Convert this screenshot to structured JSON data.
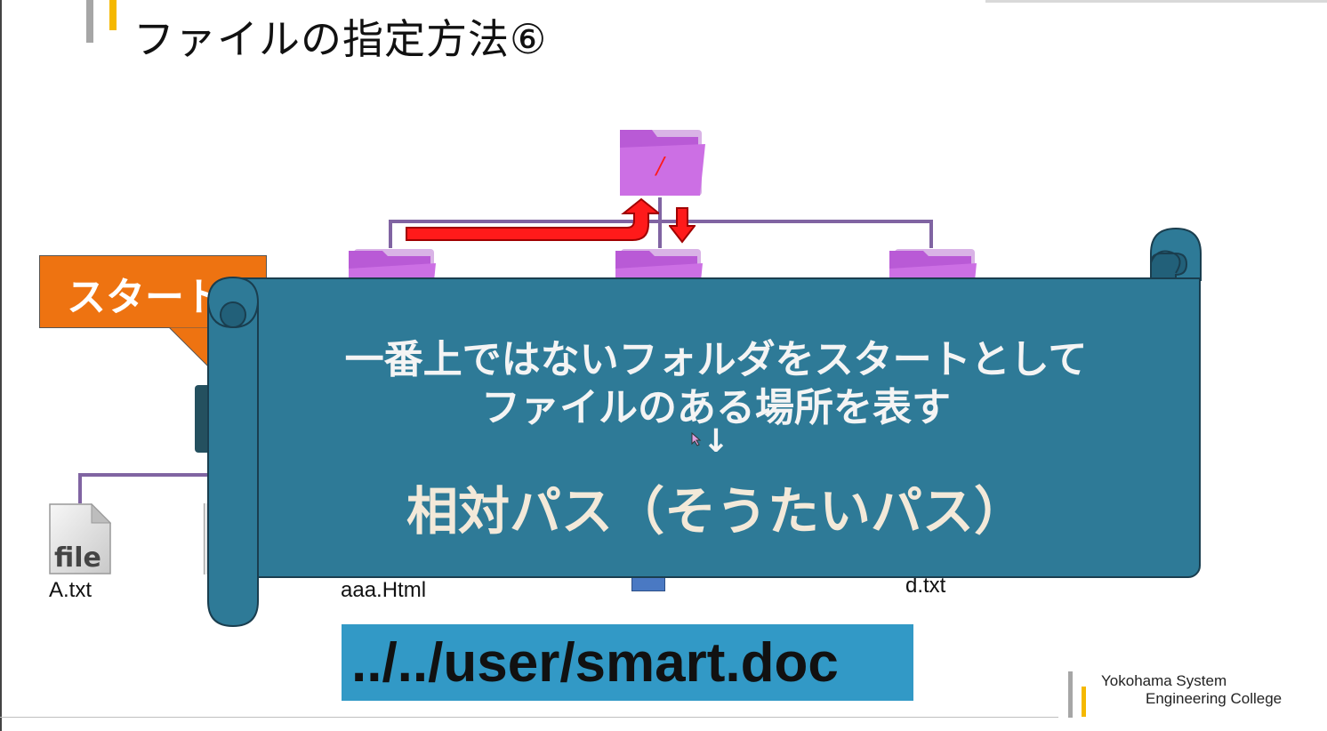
{
  "slide": {
    "title": "ファイルの指定方法⑥",
    "start_label": "スタート"
  },
  "tree": {
    "root_folder_label": "/",
    "file_labels": {
      "a": "A.txt",
      "aaa": "aaa.Html",
      "d": "d.txt"
    },
    "file_icon_text": "file"
  },
  "scroll": {
    "line1": "一番上ではないフォルダをスタートとして",
    "line2": "ファイルのある場所を表す",
    "arrow": "↓",
    "term": "相対パス（そうたいパス）"
  },
  "path_example": "../../user/smart.doc",
  "footer": {
    "college_line1": "Yokohama System",
    "college_line2": "Engineering College"
  },
  "colors": {
    "folder": "#c25ad9",
    "scroll": "#2e7a97",
    "start": "#ee7311",
    "path_box": "#3299c6",
    "arrow": "#ff1a1a",
    "tree_line": "#8064a2"
  }
}
